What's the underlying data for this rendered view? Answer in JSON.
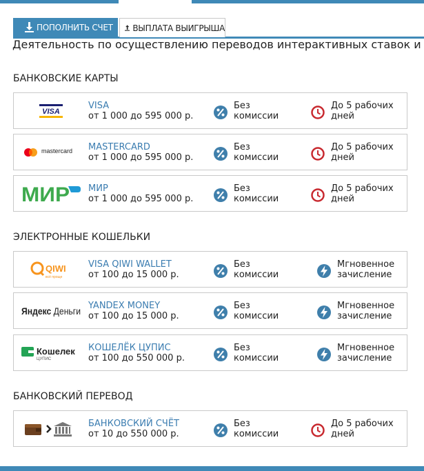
{
  "tabs": {
    "deposit_label": "ПОПОЛНИТЬ СЧЕТ",
    "withdraw_label": "ВЫПЛАТА ВЫИГРЫША",
    "active": "withdraw"
  },
  "intro": "Деятельность по осуществлению переводов интерактивных ставок и выг",
  "sections": {
    "cards": {
      "title": "БАНКОВСКИЕ КАРТЫ",
      "rows": [
        {
          "name": "VISA",
          "range": "от 1 000 до 595 000 р.",
          "fee": "Без\nкомиссии",
          "time": "До 5 рабочих\nдней",
          "logo": "visa"
        },
        {
          "name": "MASTERCARD",
          "range": "от 1 000 до 595 000 р.",
          "fee": "Без\nкомиссии",
          "time": "До 5 рабочих\nдней",
          "logo": "mastercard",
          "logo_text": "mastercard"
        },
        {
          "name": "МИР",
          "range": "от 1 000 до 595 000 р.",
          "fee": "Без\nкомиссии",
          "time": "До 5 рабочих\nдней",
          "logo": "mir"
        }
      ]
    },
    "wallets": {
      "title": "ЭЛЕКТРОННЫЕ КОШЕЛЬКИ",
      "rows": [
        {
          "name": "VISA QIWI WALLET",
          "range": "от 100 до 15 000 р.",
          "fee": "Без\nкомиссии",
          "time": "Мгновенное\nзачисление",
          "logo": "qiwi"
        },
        {
          "name": "YANDEX MONEY",
          "range": "от 100 до 15 000 р.",
          "fee": "Без\nкомиссии",
          "time": "Мгновенное\nзачисление",
          "logo": "yandex"
        },
        {
          "name": "КОШЕЛЁК ЦУПИС",
          "range": "от 100 до 550 000 р.",
          "fee": "Без\nкомиссии",
          "time": "Мгновенное\nзачисление",
          "logo": "cupis"
        }
      ]
    },
    "bank": {
      "title": "БАНКОВСКИЙ ПЕРЕВОД",
      "rows": [
        {
          "name": "БАНКОВСКИЙ СЧЁТ",
          "range": "от 10 до 550 000 р.",
          "fee": "Без\nкомиссии",
          "time": "До 5 рабочих\nдней",
          "logo": "bank-transfer"
        }
      ]
    }
  },
  "icons": {
    "fee": "percent-icon",
    "time_slow": "clock-icon",
    "time_instant": "lightning-icon"
  },
  "colors": {
    "accent": "#3f89b7",
    "link": "#3a7cb0",
    "clock": "#c8292f",
    "mir_green": "#3eaa4e",
    "qiwi_orange": "#f7941d",
    "cupis_green": "#23a455"
  }
}
